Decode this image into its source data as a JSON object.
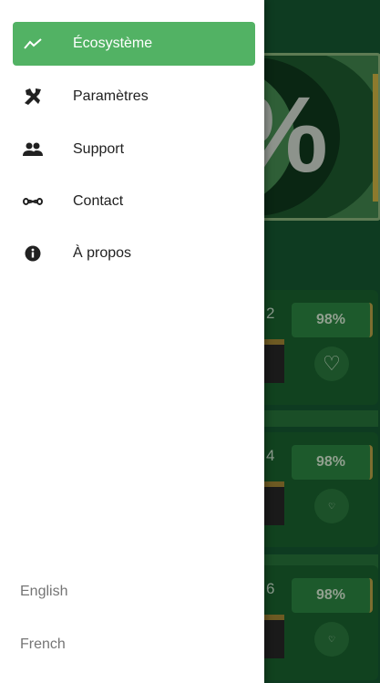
{
  "background": {
    "hero_symbol": "%",
    "cards": [
      {
        "number": "2",
        "badge": "98%",
        "icon": "heart-outline-icon"
      },
      {
        "number": "4",
        "badge": "98%",
        "icon": "heart-outline-icon"
      },
      {
        "number": "6",
        "badge": "98%",
        "icon": "heart-outline-icon"
      }
    ]
  },
  "drawer": {
    "items": [
      {
        "label": "Écosystème",
        "icon": "trending-line-icon",
        "active": true
      },
      {
        "label": "Paramètres",
        "icon": "tools-icon",
        "active": false
      },
      {
        "label": "Support",
        "icon": "users-icon",
        "active": false
      },
      {
        "label": "Contact",
        "icon": "infinity-icon",
        "active": false
      },
      {
        "label": "À propos",
        "icon": "info-icon",
        "active": false
      }
    ],
    "languages": [
      "English",
      "French"
    ]
  },
  "colors": {
    "accent": "#52b264",
    "background": "#0e3b21"
  }
}
